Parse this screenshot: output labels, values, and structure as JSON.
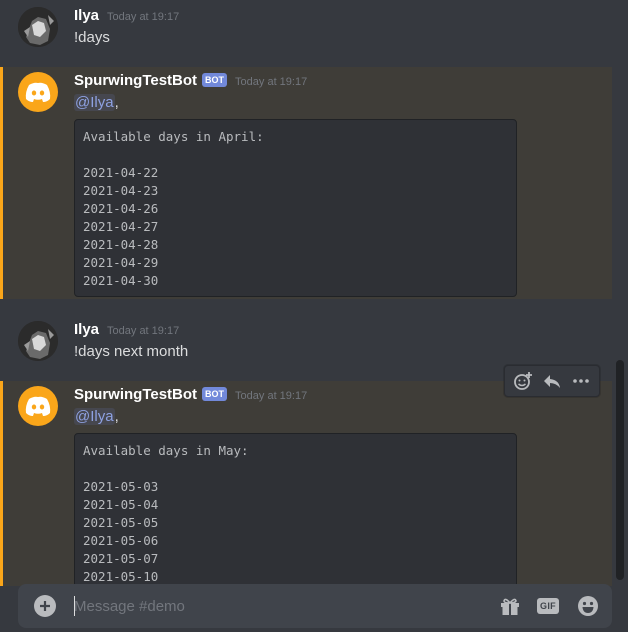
{
  "channel": {
    "placeholder": "Message #demo"
  },
  "messages": [
    {
      "author": "Ilya",
      "timestamp": "Today at 19:17",
      "text": "!days"
    },
    {
      "author": "SpurwingTestBot",
      "bot_tag": "BOT",
      "timestamp": "Today at 19:17",
      "mention": "@Ilya",
      "mention_suffix": ",",
      "code_lines": [
        "Available days in April:",
        "",
        "2021-04-22",
        "2021-04-23",
        "2021-04-26",
        "2021-04-27",
        "2021-04-28",
        "2021-04-29",
        "2021-04-30"
      ]
    },
    {
      "author": "Ilya",
      "timestamp": "Today at 19:17",
      "text": "!days next month"
    },
    {
      "author": "SpurwingTestBot",
      "bot_tag": "BOT",
      "timestamp": "Today at 19:17",
      "mention": "@Ilya",
      "mention_suffix": ",",
      "code_lines": [
        "Available days in May:",
        "",
        "2021-05-03",
        "2021-05-04",
        "2021-05-05",
        "2021-05-06",
        "2021-05-07",
        "2021-05-10"
      ]
    }
  ],
  "icons": {
    "add_reaction": "add-reaction-icon",
    "reply": "reply-icon",
    "more": "more-icon",
    "gift": "gift-icon",
    "gif": "GIF",
    "emoji": "emoji-icon",
    "upload": "plus-icon"
  },
  "colors": {
    "mention_bar": "#faa61a",
    "bot_tag": "#7289da",
    "bot_avatar": "#faa61a"
  }
}
